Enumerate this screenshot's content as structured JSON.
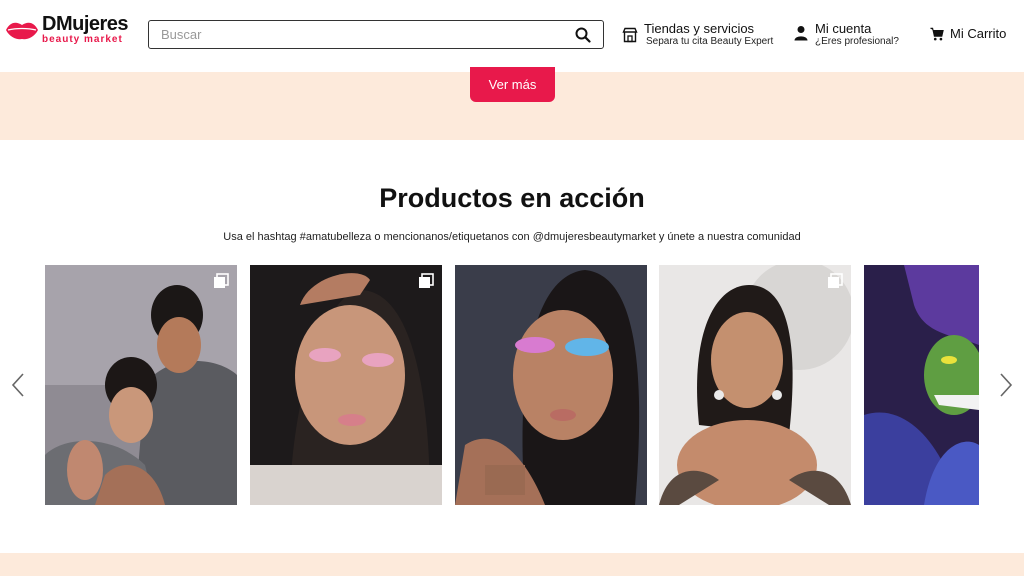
{
  "header": {
    "logo_main": "DMujeres",
    "logo_sub": "beauty market",
    "search_placeholder": "Buscar",
    "stores_title": "Tiendas y servicios",
    "stores_sub": "Separa tu cita Beauty Expert",
    "account_title": "Mi cuenta",
    "account_sub": "¿Eres profesional?",
    "cart_label": "Mi Carrito"
  },
  "promo": {
    "more_button": "Ver más"
  },
  "section": {
    "title": "Productos en acción",
    "subtitle": "Usa el hashtag #amatubelleza o mencionanos/etiquetanos con @dmujeresbeautymarket y únete a nuestra comunidad"
  },
  "colors": {
    "brand": "#e8194b",
    "peach": "#fdeadb"
  },
  "icons": {
    "search": "search-icon",
    "store": "store-icon",
    "user": "user-icon",
    "cart": "cart-icon",
    "prev": "chevron-left-icon",
    "next": "chevron-right-icon",
    "multi": "multiple-images-icon"
  }
}
